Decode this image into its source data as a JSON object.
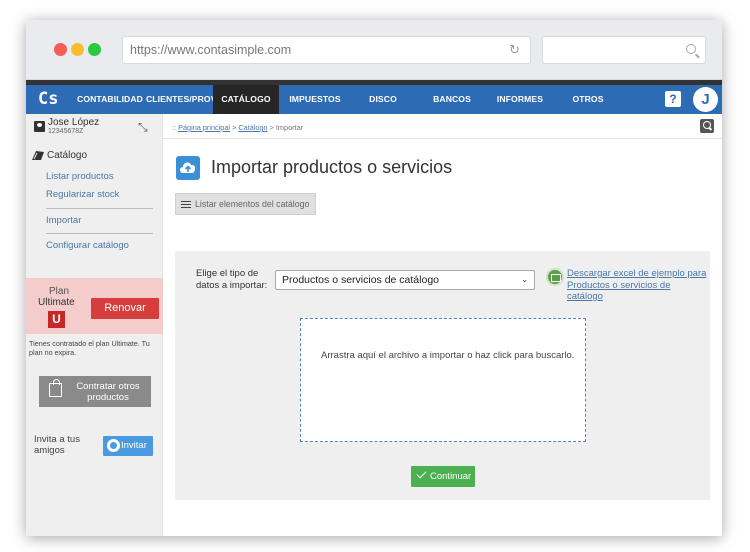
{
  "browser": {
    "url": "https://www.contasimple.com",
    "icons": [
      "reload-icon",
      "search-icon"
    ]
  },
  "colors": {
    "navbar": "#2e6bb5",
    "nav_active": "#262626",
    "renew": "#d63e3e",
    "plan_bg": "#f4cccc",
    "continue": "#4caf50",
    "invite": "#4a9ae2",
    "link": "#4a78a8"
  },
  "navbar": {
    "logo": "Cs",
    "items": [
      {
        "label": "CONTABILIDAD",
        "active": false
      },
      {
        "label": "CLIENTES/PROV.",
        "active": false
      },
      {
        "label": "CATÁLOGO",
        "active": true
      },
      {
        "label": "IMPUESTOS",
        "active": false
      },
      {
        "label": "DISCO VIRTUAL",
        "active": false
      },
      {
        "label": "BANCOS",
        "active": false
      },
      {
        "label": "INFORMES",
        "active": false
      },
      {
        "label": "OTROS",
        "active": false
      }
    ],
    "help": "?",
    "avatar": "J"
  },
  "sidebar": {
    "user_name": "Jose López",
    "user_id": "12345678Z",
    "section_title": "Catálogo",
    "links": [
      "Listar productos",
      "Regularizar stock",
      "Importar",
      "Configurar catálogo"
    ],
    "plan": {
      "label": "Plan",
      "name": "Ultimate",
      "badge": "U",
      "renew": "Renovar",
      "note": "Tienes contratado el plan Ultimate. Tu plan no expira."
    },
    "contract_btn": "Contratar otros productos",
    "invite_text": "Invita a tus amigos",
    "invite_btn": "Invitar"
  },
  "breadcrumb": {
    "prefix": "::",
    "home": "Página principal",
    "catalog": "Catálogo",
    "current": "Importar"
  },
  "main": {
    "title": "Importar productos o servicios",
    "list_btn": "Listar elementos del catálogo",
    "type_label": "Elige el tipo de datos a importar:",
    "type_selected": "Productos o servicios de catálogo",
    "excel_link": "Descargar excel de ejemplo para Productos o servicios de catálogo",
    "drop_text": "Arrastra aquí el archivo a importar o haz click para buscarlo.",
    "continue_btn": "Continuar"
  }
}
